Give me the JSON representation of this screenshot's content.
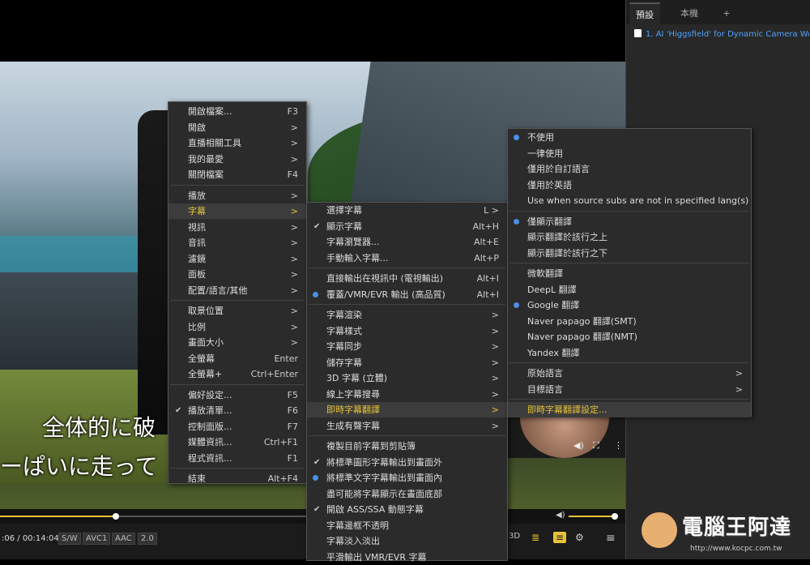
{
  "video": {
    "subtitle_line1": "全体的に破",
    "subtitle_line2": "ーぱいに走って"
  },
  "controls": {
    "time": ":06 / 00:14:04",
    "tags": [
      "S/W",
      "AVC1",
      "AAC",
      "2.0"
    ],
    "seek_progress": 0.23,
    "right_buttons": [
      "3D",
      "playlist-icon",
      "subtitle-icon",
      "gear-icon",
      "menu-icon"
    ]
  },
  "panel": {
    "tabs": [
      "預設",
      "本機",
      "+"
    ],
    "playlist_item": "1. AI 'Higgsfield' for Dynamic Camera Wo...",
    "watermark": "電腦王阿達",
    "watermark_url": "http://www.kocpc.com.tw"
  },
  "main_menu": [
    {
      "label": "開啟檔案...",
      "shortcut": "F3"
    },
    {
      "label": "開啟",
      "shortcut": ">"
    },
    {
      "label": "直播相關工具",
      "shortcut": ">"
    },
    {
      "label": "我的最愛",
      "shortcut": ">"
    },
    {
      "label": "關閉檔案",
      "shortcut": "F4"
    },
    {
      "label": "播放",
      "shortcut": ">"
    },
    {
      "label": "字幕",
      "shortcut": ">"
    },
    {
      "label": "視訊",
      "shortcut": ">"
    },
    {
      "label": "音訊",
      "shortcut": ">"
    },
    {
      "label": "濾鏡",
      "shortcut": ">"
    },
    {
      "label": "面板",
      "shortcut": ">"
    },
    {
      "label": "配置/語言/其他",
      "shortcut": ">"
    },
    {
      "label": "取景位置",
      "shortcut": ">"
    },
    {
      "label": "比例",
      "shortcut": ">"
    },
    {
      "label": "畫面大小",
      "shortcut": ">"
    },
    {
      "label": "全螢幕",
      "shortcut": "Enter"
    },
    {
      "label": "全螢幕+",
      "shortcut": "Ctrl+Enter"
    },
    {
      "label": "偏好設定...",
      "shortcut": "F5"
    },
    {
      "label": "播放清單...",
      "shortcut": "F6"
    },
    {
      "label": "控制面版...",
      "shortcut": "F7"
    },
    {
      "label": "媒體資訊...",
      "shortcut": "Ctrl+F1"
    },
    {
      "label": "程式資訊...",
      "shortcut": "F1"
    },
    {
      "label": "結束",
      "shortcut": "Alt+F4"
    }
  ],
  "subtitle_menu": [
    {
      "label": "選擇字幕",
      "shortcut": "L >"
    },
    {
      "label": "顯示字幕",
      "shortcut": "Alt+H"
    },
    {
      "label": "字幕瀏覽器...",
      "shortcut": "Alt+E"
    },
    {
      "label": "手動輸入字幕...",
      "shortcut": "Alt+P"
    },
    {
      "label": "直接輸出在視訊中 (電視輸出)",
      "shortcut": "Alt+I"
    },
    {
      "label": "覆蓋/VMR/EVR 輸出 (高品質)",
      "shortcut": "Alt+I"
    },
    {
      "label": "字幕渲染",
      "shortcut": ">"
    },
    {
      "label": "字幕樣式",
      "shortcut": ">"
    },
    {
      "label": "字幕同步",
      "shortcut": ">"
    },
    {
      "label": "儲存字幕",
      "shortcut": ">"
    },
    {
      "label": "3D 字幕 (立體)",
      "shortcut": ">"
    },
    {
      "label": "線上字幕搜尋",
      "shortcut": ">"
    },
    {
      "label": "即時字幕翻譯",
      "shortcut": ">"
    },
    {
      "label": "生成有聲字幕",
      "shortcut": ">"
    },
    {
      "label": "複製目前字幕到剪貼簿",
      "shortcut": ""
    },
    {
      "label": "將標準圖形字幕輸出到畫面外",
      "shortcut": ""
    },
    {
      "label": "將標準文字字幕輸出到畫面內",
      "shortcut": ""
    },
    {
      "label": "盡可能將字幕顯示在畫面底部",
      "shortcut": ""
    },
    {
      "label": "開啟 ASS/SSA 動態字幕",
      "shortcut": ""
    },
    {
      "label": "字幕邊框不透明",
      "shortcut": ""
    },
    {
      "label": "字幕淡入淡出",
      "shortcut": ""
    },
    {
      "label": "平滑輸出 VMR/EVR 字幕",
      "shortcut": ""
    }
  ],
  "translate_menu": [
    {
      "label": "不使用",
      "shortcut": ""
    },
    {
      "label": "一律使用",
      "shortcut": ""
    },
    {
      "label": "僅用於自訂語言",
      "shortcut": ""
    },
    {
      "label": "僅用於英語",
      "shortcut": ""
    },
    {
      "label": "Use when source subs are not in specified lang(s)",
      "shortcut": ""
    },
    {
      "label": "僅顯示翻譯",
      "shortcut": ""
    },
    {
      "label": "顯示翻譯於該行之上",
      "shortcut": ""
    },
    {
      "label": "顯示翻譯於該行之下",
      "shortcut": ""
    },
    {
      "label": "微軟翻譯",
      "shortcut": ""
    },
    {
      "label": "DeepL 翻譯",
      "shortcut": ""
    },
    {
      "label": "Google 翻譯",
      "shortcut": ""
    },
    {
      "label": "Naver papago 翻譯(SMT)",
      "shortcut": ""
    },
    {
      "label": "Naver papago 翻譯(NMT)",
      "shortcut": ""
    },
    {
      "label": "Yandex 翻譯",
      "shortcut": ""
    },
    {
      "label": "原始語言",
      "shortcut": ">"
    },
    {
      "label": "目標語言",
      "shortcut": ">"
    },
    {
      "label": "即時字幕翻譯設定...",
      "shortcut": ""
    }
  ]
}
